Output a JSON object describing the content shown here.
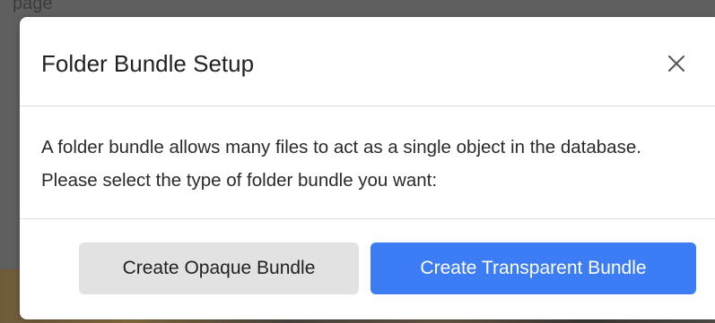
{
  "background": {
    "partial_text": "page"
  },
  "modal": {
    "title": "Folder Bundle Setup",
    "close_icon": "close-icon",
    "body": "A folder bundle allows many files to act as a single object in the database. Please select the type of folder bundle you want:",
    "buttons": {
      "opaque_label": "Create Opaque Bundle",
      "transparent_label": "Create Transparent Bundle"
    }
  },
  "colors": {
    "primary": "#3c7cf4",
    "secondary": "#e2e2e2",
    "overlay": "#5f5f5f"
  }
}
